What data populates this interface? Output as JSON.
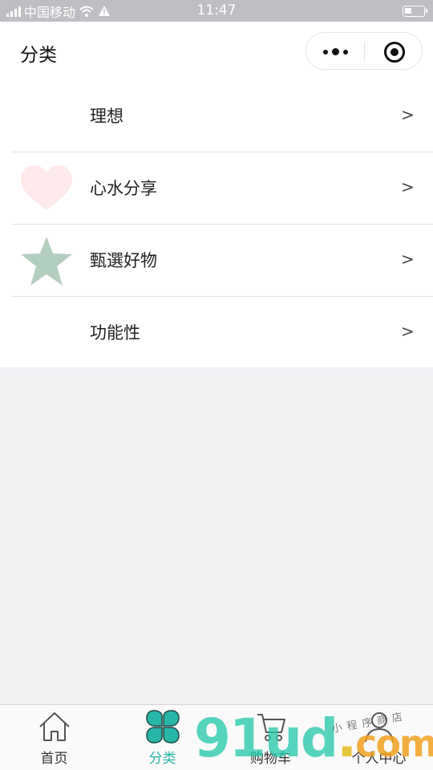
{
  "status_bar": {
    "carrier": "中国移动",
    "time": "11:47"
  },
  "header": {
    "title": "分类",
    "more_icon": "more-dots-icon",
    "close_icon": "target-close-icon"
  },
  "categories": [
    {
      "label": "理想",
      "arrow": ">",
      "icon": "none"
    },
    {
      "label": "心水分享",
      "arrow": ">",
      "icon": "heart-icon"
    },
    {
      "label": "甄選好物",
      "arrow": ">",
      "icon": "star-icon"
    },
    {
      "label": "功能性",
      "arrow": ">",
      "icon": "none"
    }
  ],
  "colors": {
    "heart": "#fde9ea",
    "star": "#b3cdbf",
    "accent": "#28b6a9",
    "status_bar": "#bfbec2"
  },
  "tabbar": {
    "active_index": 1,
    "items": [
      {
        "label": "首页",
        "icon": "home-icon"
      },
      {
        "label": "分类",
        "icon": "clover-icon"
      },
      {
        "label": "购物车",
        "icon": "cart-icon"
      },
      {
        "label": "个人中心",
        "icon": "user-icon"
      }
    ]
  },
  "watermark": {
    "main": "91ud",
    "dot": ".",
    "suffix": "com",
    "handwriting": "小程序商店"
  }
}
